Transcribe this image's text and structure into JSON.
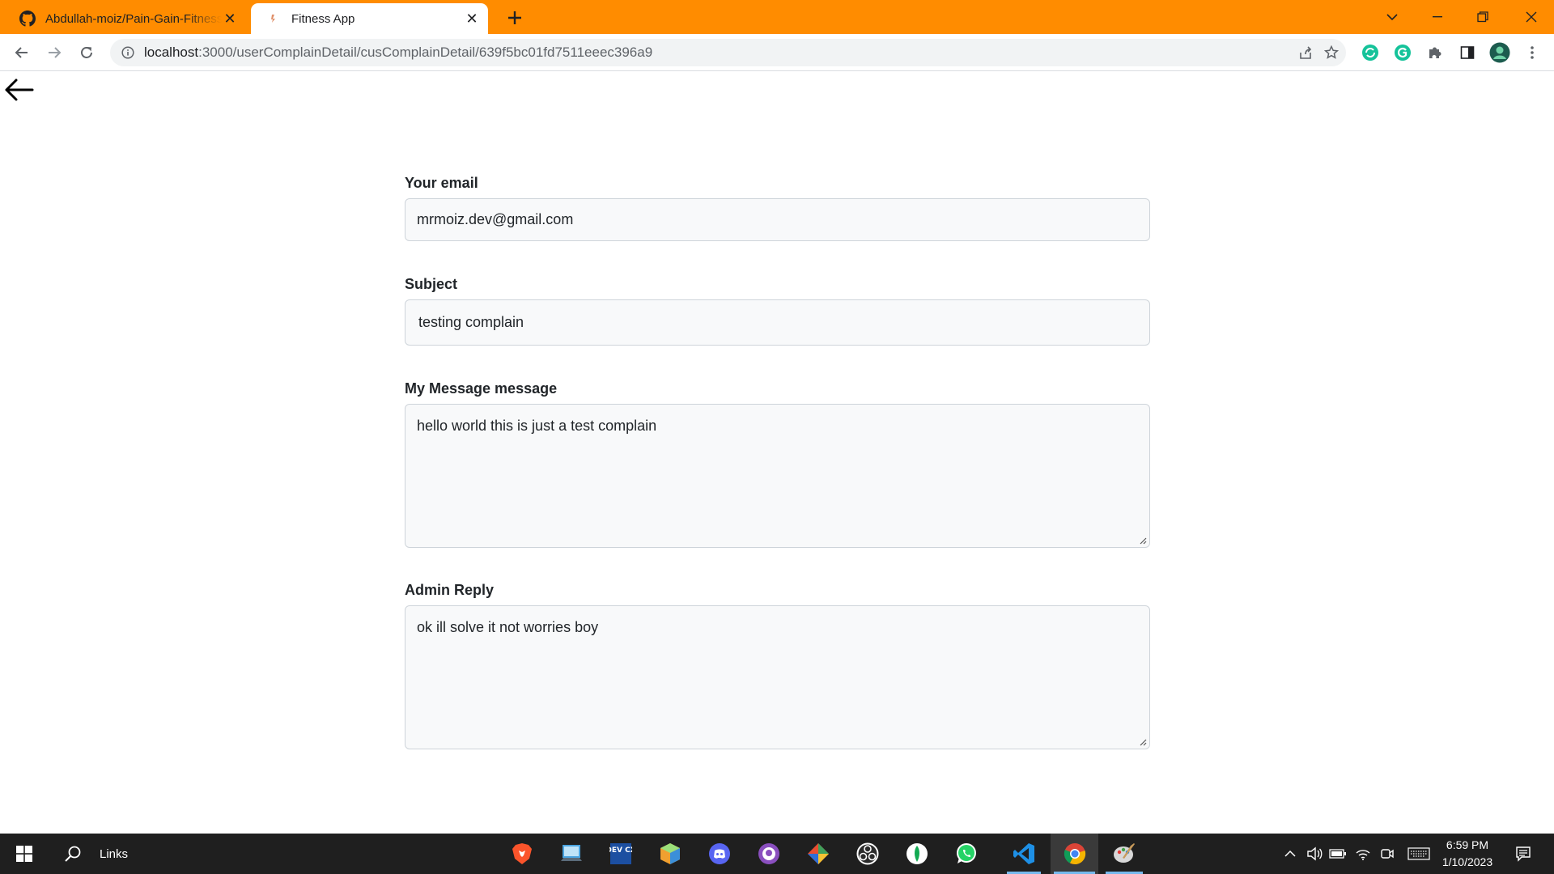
{
  "browser": {
    "tabs": [
      {
        "title": "Abdullah-moiz/Pain-Gain-Fitness",
        "favicon": "github-icon",
        "active": false
      },
      {
        "title": "Fitness App",
        "favicon": "fitness-icon",
        "active": true
      }
    ],
    "url_host": "localhost",
    "url_path": ":3000/userComplainDetail/cusComplainDetail/639f5bc01fd7511eeec396a9",
    "accent_color": "#ff8c00"
  },
  "form": {
    "email_label": "Your email",
    "email_value": "mrmoiz.dev@gmail.com",
    "subject_label": "Subject",
    "subject_value": "testing complain",
    "message_label": "My Message message",
    "message_value": "hello world this is just a test complain",
    "reply_label": "Admin Reply",
    "reply_value": "ok ill solve it not worries boy"
  },
  "taskbar": {
    "search_label": "Links",
    "apps": [
      "brave-icon",
      "computer-icon",
      "devcx-icon",
      "cube-icon",
      "discord-icon",
      "github-desktop-icon",
      "git-icon",
      "obs-icon",
      "mongodb-icon",
      "whatsapp-icon",
      "vscode-icon",
      "chrome-icon",
      "paint-icon"
    ],
    "devcx_label": "DEV CX",
    "time": "6:59 PM",
    "date": "1/10/2023"
  }
}
